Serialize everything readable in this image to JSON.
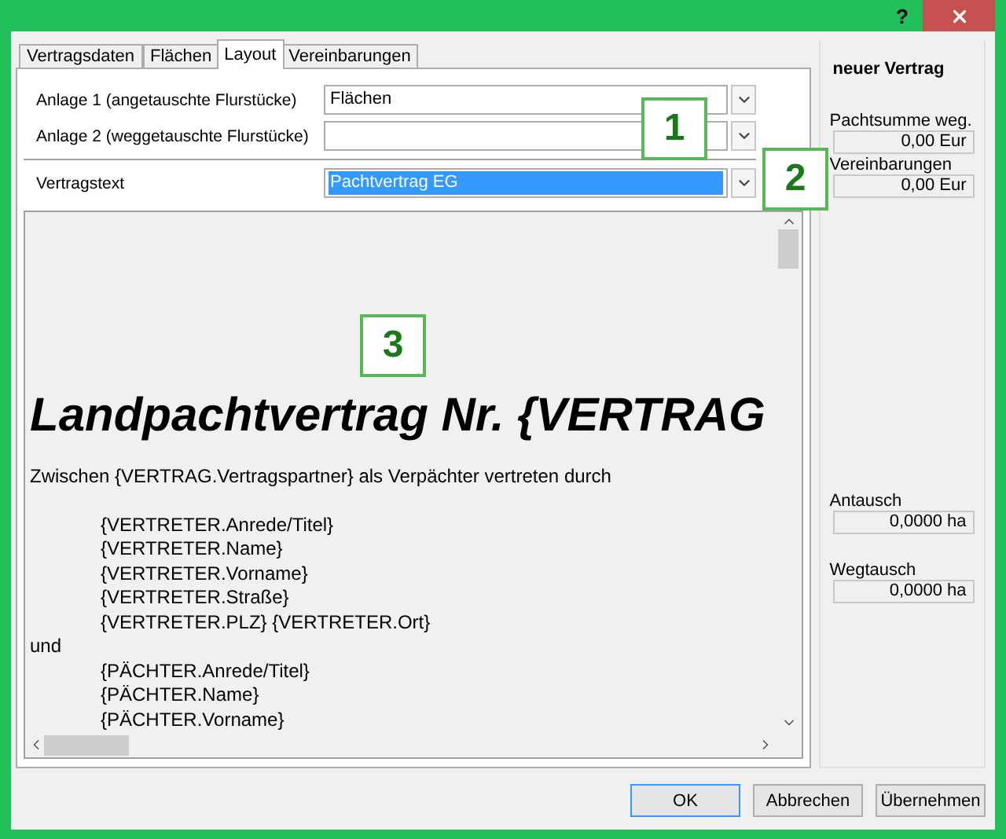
{
  "window": {
    "help": "?"
  },
  "tabs": [
    {
      "label": "Vertragsdaten",
      "selected": false
    },
    {
      "label": "Flächen",
      "selected": false
    },
    {
      "label": "Layout",
      "selected": true
    },
    {
      "label": "Vereinbarungen",
      "selected": false
    }
  ],
  "fields": [
    {
      "label": "Anlage 1 (angetauschte Flurstücke)",
      "value": "Flächen",
      "highlighted": false
    },
    {
      "label": "Anlage 2 (weggetauschte Flurstücke)",
      "highlighted": false
    },
    {
      "label": "Vertragstext",
      "value": "Pachtvertrag EG",
      "highlighted": true
    }
  ],
  "document": {
    "heading": "Landpachtvertrag Nr. {VERTRAG",
    "intro": "Zwischen {VERTRAG.Vertragspartner} als Verpächter vertreten durch",
    "lines": [
      {
        "text": "{VERTRETER.Anrede/Titel}",
        "indent": true
      },
      {
        "text": "{VERTRETER.Name}",
        "indent": true
      },
      {
        "text": "{VERTRETER.Vorname}",
        "indent": true
      },
      {
        "text": "{VERTRETER.Straße}",
        "indent": true
      },
      {
        "text": "{VERTRETER.PLZ} {VERTRETER.Ort}",
        "indent": true
      },
      {
        "text": "und",
        "indent": false
      },
      {
        "text": "{PÄCHTER.Anrede/Titel}",
        "indent": true
      },
      {
        "text": "{PÄCHTER.Name}",
        "indent": true
      },
      {
        "text": "{PÄCHTER.Vorname}",
        "indent": true
      }
    ]
  },
  "callouts": [
    "1",
    "2",
    "3"
  ],
  "side": {
    "title": "neuer Vertrag",
    "sums": [
      {
        "label": "Pachtsumme weg.",
        "value": "0,00 Eur"
      },
      {
        "label": "Vereinbarungen",
        "value": "0,00 Eur"
      }
    ],
    "areas": [
      {
        "label": "Antausch",
        "value": "0,0000 ha"
      },
      {
        "label": "Wegtausch",
        "value": "0,0000 ha"
      }
    ]
  },
  "buttons": [
    {
      "label": "OK",
      "default": true
    },
    {
      "label": "Abbrechen",
      "default": false
    },
    {
      "label": "Übernehmen",
      "default": false
    }
  ]
}
